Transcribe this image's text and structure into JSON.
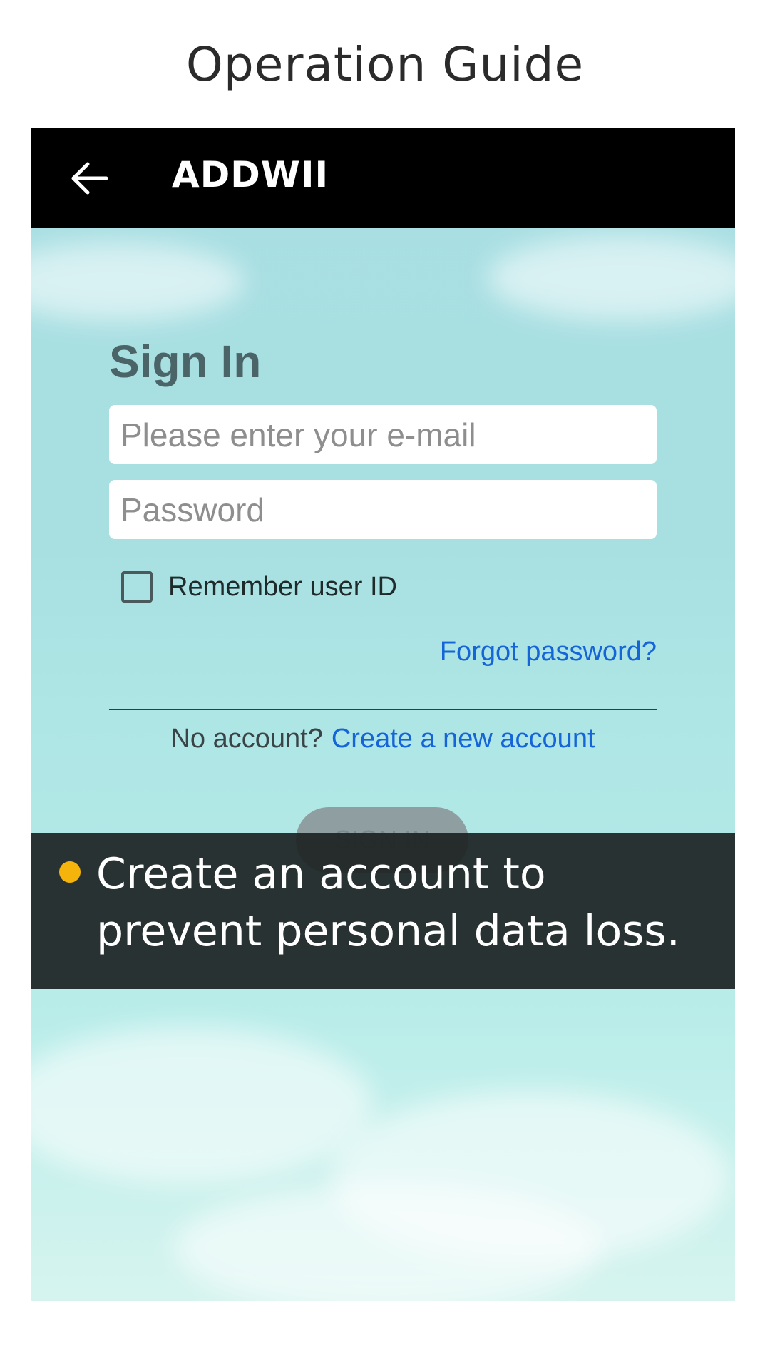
{
  "page": {
    "title": "Operation Guide"
  },
  "app_bar": {
    "back_icon": "arrow-left-icon",
    "title": "ADDWII"
  },
  "sign_in": {
    "heading": "Sign In",
    "email_placeholder": "Please enter your e-mail",
    "email_value": "",
    "password_placeholder": "Password",
    "password_value": "",
    "remember_label": "Remember user ID",
    "remember_checked": false,
    "forgot_link": "Forgot password?",
    "no_account_text": "No account?",
    "create_account_link": "Create a new account",
    "submit_label": "SIGN IN"
  },
  "guide": {
    "bullet_color": "#f5b40c",
    "text": "Create an account to prevent personal data loss."
  },
  "colors": {
    "link": "#1565d8",
    "app_bar": "#000000",
    "overlay": "#1e2324"
  }
}
